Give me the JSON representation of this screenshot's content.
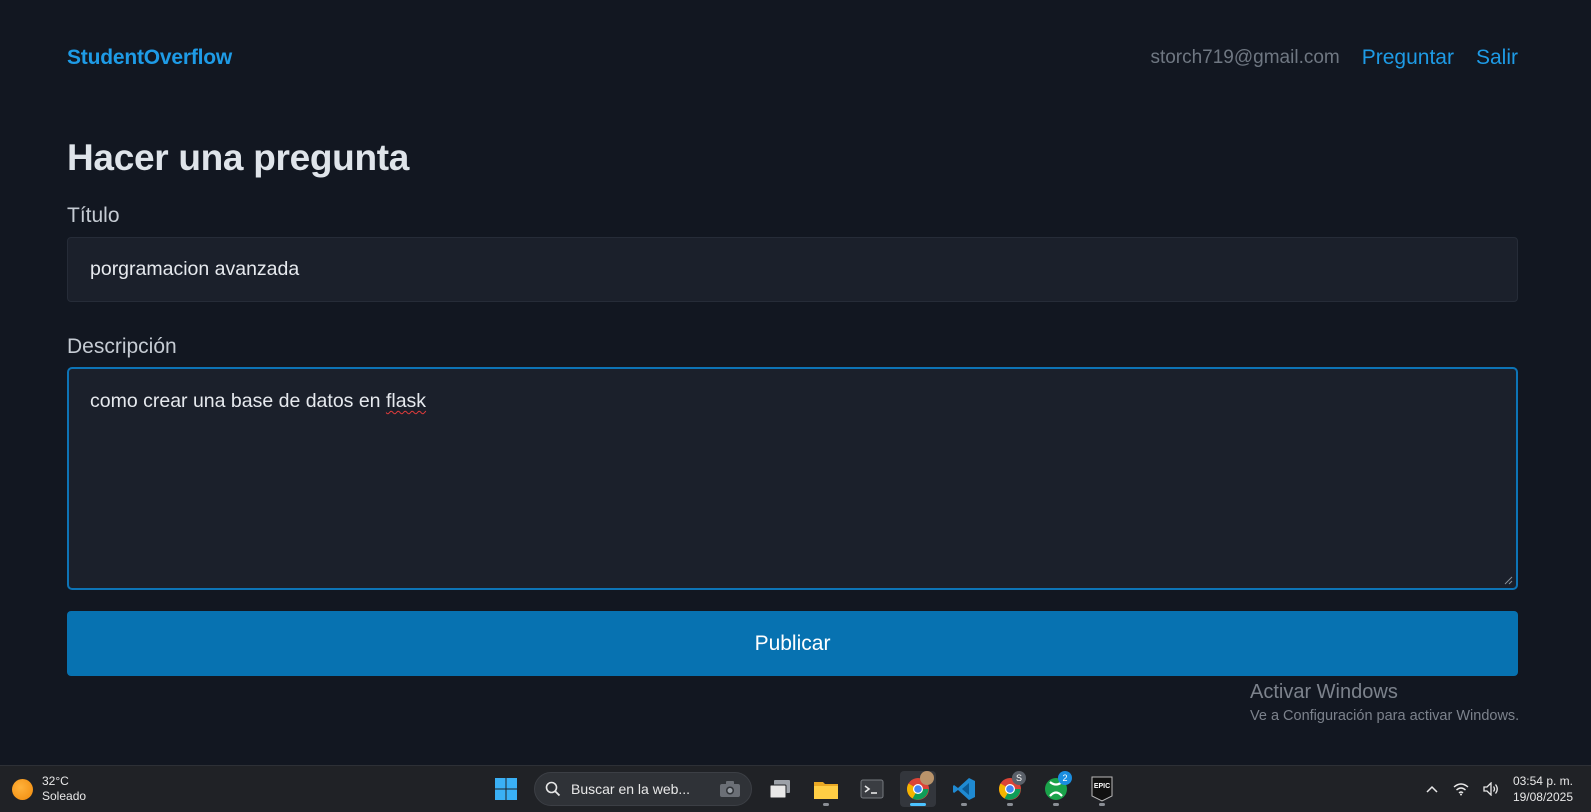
{
  "header": {
    "brand": "StudentOverflow",
    "user_email": "storch719@gmail.com",
    "nav_ask": "Preguntar",
    "nav_logout": "Salir"
  },
  "form": {
    "heading": "Hacer una pregunta",
    "title_label": "Título",
    "title_value": "porgramacion avanzada",
    "description_label": "Descripción",
    "description_text": "como crear una base de datos en ",
    "description_misspelled": "flask",
    "submit_label": "Publicar"
  },
  "watermark": {
    "line1": "Activar Windows",
    "line2": "Ve a Configuración para activar Windows."
  },
  "taskbar": {
    "weather_temp": "32°C",
    "weather_desc": "Soleado",
    "search_placeholder": "Buscar en la web...",
    "chrome_badge": "S",
    "xbox_badge": "2",
    "epic_label": "EPIC",
    "time": "03:54 p. m.",
    "date": "19/08/2025"
  },
  "colors": {
    "background": "#121721",
    "accent": "#1e9be6",
    "button": "#0772b1",
    "focus_border": "#0d74b6"
  }
}
